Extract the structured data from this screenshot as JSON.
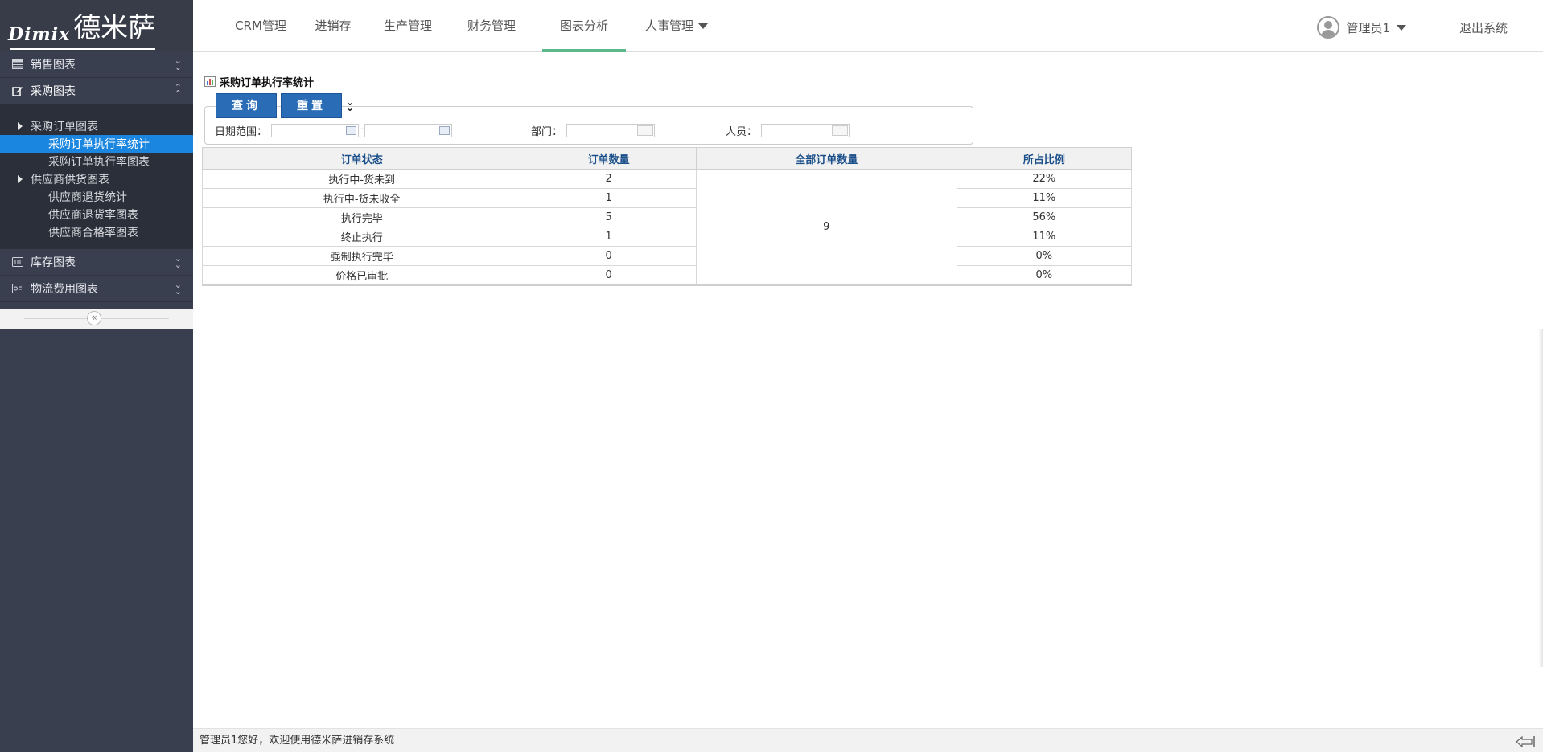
{
  "brand": {
    "latin": "Dimix",
    "cjk": "德米萨"
  },
  "sidebar": {
    "sections": [
      {
        "label": "销售图表"
      },
      {
        "label": "采购图表"
      },
      {
        "label": "库存图表"
      },
      {
        "label": "物流费用图表"
      }
    ],
    "purchase_groups": [
      {
        "label": "采购订单图表",
        "items": [
          "采购订单执行率统计",
          "采购订单执行率图表"
        ]
      },
      {
        "label": "供应商供货图表",
        "items": [
          "供应商退货统计",
          "供应商退货率图表",
          "供应商合格率图表"
        ]
      }
    ],
    "selected_item": "采购订单执行率统计"
  },
  "topnav": {
    "items": [
      "CRM管理",
      "进销存",
      "生产管理",
      "财务管理",
      "图表分析",
      "人事管理"
    ],
    "active": "图表分析"
  },
  "user": {
    "name": "管理员1",
    "logout": "退出系统"
  },
  "panel": {
    "title": "采购订单执行率统计",
    "query_button": "查询",
    "reset_button": "重置",
    "filters": {
      "date_label": "日期范围：",
      "date_sep": "-",
      "dept_label": "部门：",
      "person_label": "人员："
    }
  },
  "table": {
    "headers": [
      "订单状态",
      "订单数量",
      "全部订单数量",
      "所占比例"
    ],
    "total": "9",
    "rows": [
      {
        "status": "执行中-货未到",
        "count": "2",
        "ratio": "22%"
      },
      {
        "status": "执行中-货未收全",
        "count": "1",
        "ratio": "11%"
      },
      {
        "status": "执行完毕",
        "count": "5",
        "ratio": "56%"
      },
      {
        "status": "终止执行",
        "count": "1",
        "ratio": "11%"
      },
      {
        "status": "强制执行完毕",
        "count": "0",
        "ratio": "0%"
      },
      {
        "status": "价格已审批",
        "count": "0",
        "ratio": "0%"
      }
    ]
  },
  "status_bar": {
    "text": "管理员1您好，欢迎使用德米萨进销存系统"
  },
  "colors": {
    "sidebar_bg": "#3a3f50",
    "selected": "#1a86e0",
    "tab_underline": "#5cb88a",
    "button": "#2a6db6",
    "header_text": "#1b4f8a"
  }
}
